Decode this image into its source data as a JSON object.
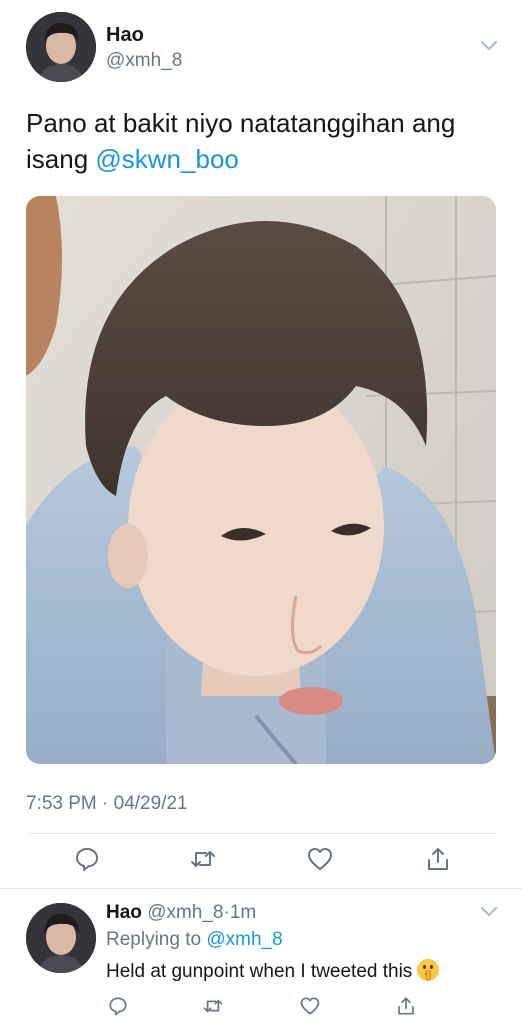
{
  "tweet": {
    "author_name": "Hao",
    "author_handle": "@xmh_8",
    "text_before_mention": "Pano at bakit niyo natatanggihan ang isang ",
    "mention": "@skwn_boo",
    "timestamp": "7:53 PM · 04/29/21"
  },
  "actions": [
    "reply-icon",
    "retweet-icon",
    "like-icon",
    "share-icon"
  ],
  "reply": {
    "author_name": "Hao",
    "author_handle": "@xmh_8",
    "separator": "·",
    "age": "1m",
    "replying_prefix": "Replying to ",
    "replying_to": "@xmh_8",
    "text": "Held at gunpoint when I tweeted this",
    "emoji": "shushing-face-emoji"
  },
  "colors": {
    "link": "#1b95e0",
    "secondary_text": "#657786",
    "divider": "#e1e8ed",
    "hoodie": "#a9bfd6"
  }
}
